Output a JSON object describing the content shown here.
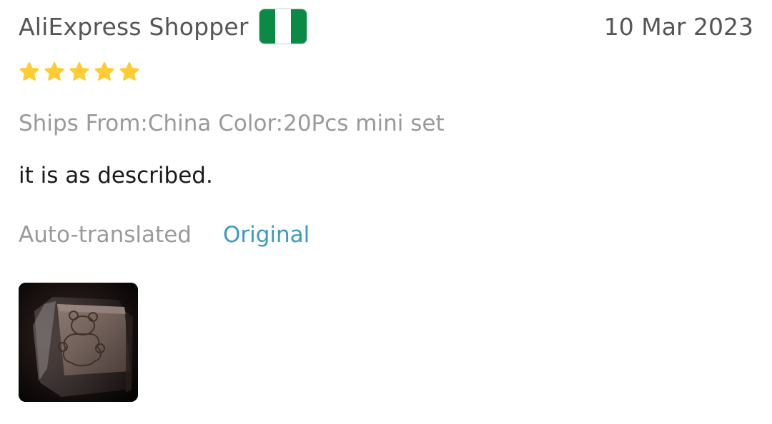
{
  "review": {
    "reviewer_name": "AliExpress Shopper",
    "flag": {
      "icon": "nigeria-flag-icon",
      "colors": [
        "#0b8a45",
        "#ffffff",
        "#0b8a45"
      ]
    },
    "date": "10 Mar 2023",
    "rating": {
      "value": 5,
      "max": 5,
      "star_color": "#ffcc33"
    },
    "sku_info": "Ships From:China Color:20Pcs mini set",
    "text": "it is as described.",
    "translation": {
      "status": "Auto-translated",
      "original_label": "Original",
      "link_color": "#3a9bbd"
    },
    "photos": [
      {
        "icon": "review-photo-thumbnail"
      }
    ]
  }
}
